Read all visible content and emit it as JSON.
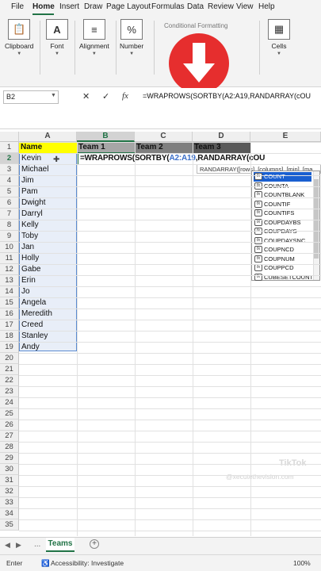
{
  "menu": [
    "File",
    "Home",
    "Insert",
    "Draw",
    "Page Layout",
    "Formulas",
    "Data",
    "Review",
    "View",
    "Help"
  ],
  "ribbon": {
    "groups": [
      {
        "label": "Clipboard",
        "icon": "clipboard-icon",
        "glyph": "📋"
      },
      {
        "label": "Font",
        "icon": "font-icon",
        "glyph": "A"
      },
      {
        "label": "Alignment",
        "icon": "alignment-icon",
        "glyph": "≡"
      },
      {
        "label": "Number",
        "icon": "percent-icon",
        "glyph": "%"
      },
      {
        "label": "Cells",
        "icon": "cells-icon",
        "glyph": "▦"
      }
    ],
    "conditional_formatting": "Conditional Formatting"
  },
  "formula_bar": {
    "name_box": "B2",
    "cancel": "✕",
    "enter": "✓",
    "fx": "fx",
    "formula": "=WRAPROWS(SORTBY(A2:A19,RANDARRAY(cOU"
  },
  "columns": [
    "A",
    "B",
    "C",
    "D",
    "E"
  ],
  "rows": [
    "1",
    "2",
    "3",
    "4",
    "5",
    "6",
    "7",
    "8",
    "9",
    "10",
    "11",
    "12",
    "13",
    "14",
    "15",
    "16",
    "17",
    "18",
    "19",
    "20",
    "21",
    "22",
    "23",
    "24",
    "25",
    "26",
    "27",
    "28",
    "29",
    "30",
    "31",
    "32",
    "33",
    "34",
    "35"
  ],
  "headers": {
    "a1": "Name",
    "b1": "Team 1",
    "c1": "Team 2",
    "d1": "Team 3"
  },
  "names": [
    "Kevin",
    "Michael",
    "Jim",
    "Pam",
    "Dwight",
    "Darryl",
    "Kelly",
    "Toby",
    "Jan",
    "Holly",
    "Gabe",
    "Erin",
    "Jo",
    "Angela",
    "Meredith",
    "Creed",
    "Stanley",
    "Andy"
  ],
  "editing_formula_part1": "=WRAPROWS(SORTBY(",
  "editing_formula_ref": "A2:A19",
  "editing_formula_part2": ",RANDARRAY(cOU",
  "tooltip": "RANDARRAY([rows], [columns], [min], [ma",
  "autocomplete": [
    "COUNT",
    "COUNTA",
    "COUNTBLANK",
    "COUNTIF",
    "COUNTIFS",
    "COUPDAYBS",
    "COUPDAYS",
    "COUPDAYSNC",
    "COUPNCD",
    "COUPNUM",
    "COUPPCD",
    "CUBESETCOUNT"
  ],
  "autocomplete_icon": "fx",
  "watermark": {
    "brand": "TikTok",
    "handle": "@xecutethevision.com"
  },
  "sheet_tab": "Teams",
  "sheet_nav": "...",
  "add_sheet": "+",
  "status": {
    "mode": "Enter",
    "accessibility": "Accessibility: Investigate",
    "zoom": "100%"
  },
  "colors": {
    "accent": "#217346",
    "highlight": "#ffff00",
    "team_header": "#7f7f7f",
    "arrow": "#e62e2e",
    "selected_item": "#1a5fd0"
  }
}
